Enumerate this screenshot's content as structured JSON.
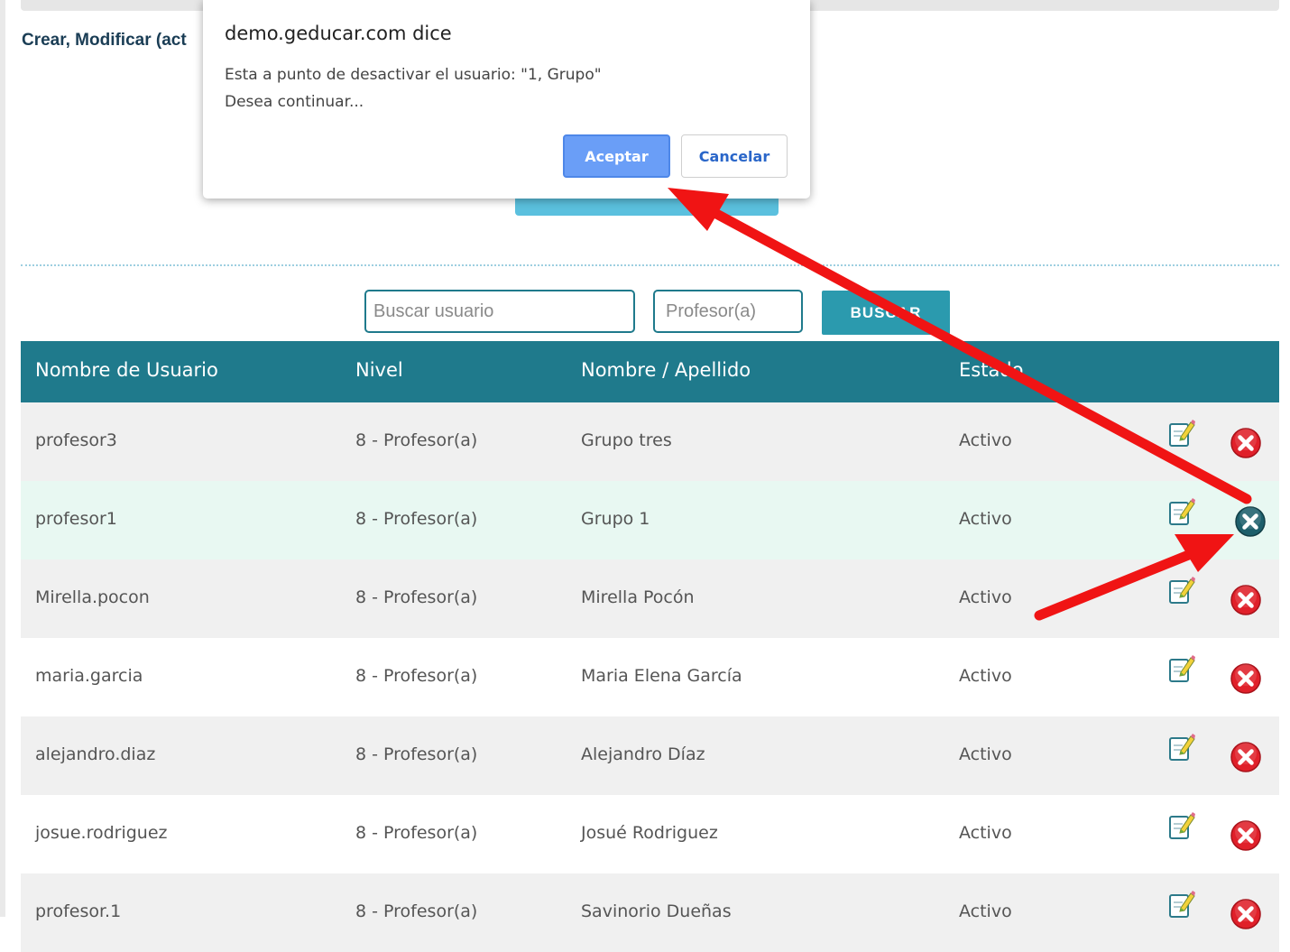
{
  "page": {
    "section_title": "Crear, Modificar (act"
  },
  "search": {
    "user_placeholder": "Buscar usuario",
    "level_placeholder": "Profesor(a)",
    "button_label": "BUSCAR"
  },
  "table": {
    "headers": [
      "Nombre de Usuario",
      "Nivel",
      "Nombre / Apellido",
      "Estado"
    ],
    "rows": [
      {
        "username": "profesor3",
        "level": "8 - Profesor(a)",
        "name": "Grupo tres",
        "status": "Activo"
      },
      {
        "username": "profesor1",
        "level": "8 - Profesor(a)",
        "name": "Grupo 1",
        "status": "Activo"
      },
      {
        "username": "Mirella.pocon",
        "level": "8 - Profesor(a)",
        "name": "Mirella Pocón",
        "status": "Activo"
      },
      {
        "username": "maria.garcia",
        "level": "8 - Profesor(a)",
        "name": "Maria Elena García",
        "status": "Activo"
      },
      {
        "username": "alejandro.diaz",
        "level": "8 - Profesor(a)",
        "name": "Alejandro Díaz",
        "status": "Activo"
      },
      {
        "username": "josue.rodriguez",
        "level": "8 - Profesor(a)",
        "name": "Josué Rodriguez",
        "status": "Activo"
      },
      {
        "username": "profesor.1",
        "level": "8 - Profesor(a)",
        "name": "Savinorio Dueñas",
        "status": "Activo"
      }
    ]
  },
  "dialog": {
    "title": "demo.geducar.com dice",
    "message_line1": "Esta a punto de desactivar el usuario: \"1, Grupo\"",
    "message_line2": "Desea continuar...",
    "accept_label": "Aceptar",
    "cancel_label": "Cancelar"
  },
  "colors": {
    "header_bg": "#1f7a8c",
    "search_button": "#2b9aae",
    "delete_red": "#e0202a",
    "delete_active": "#1d5f6b",
    "annotation_arrow": "#f01414"
  },
  "icons": {
    "edit": "edit-note-icon",
    "delete": "delete-x-circle-icon"
  }
}
